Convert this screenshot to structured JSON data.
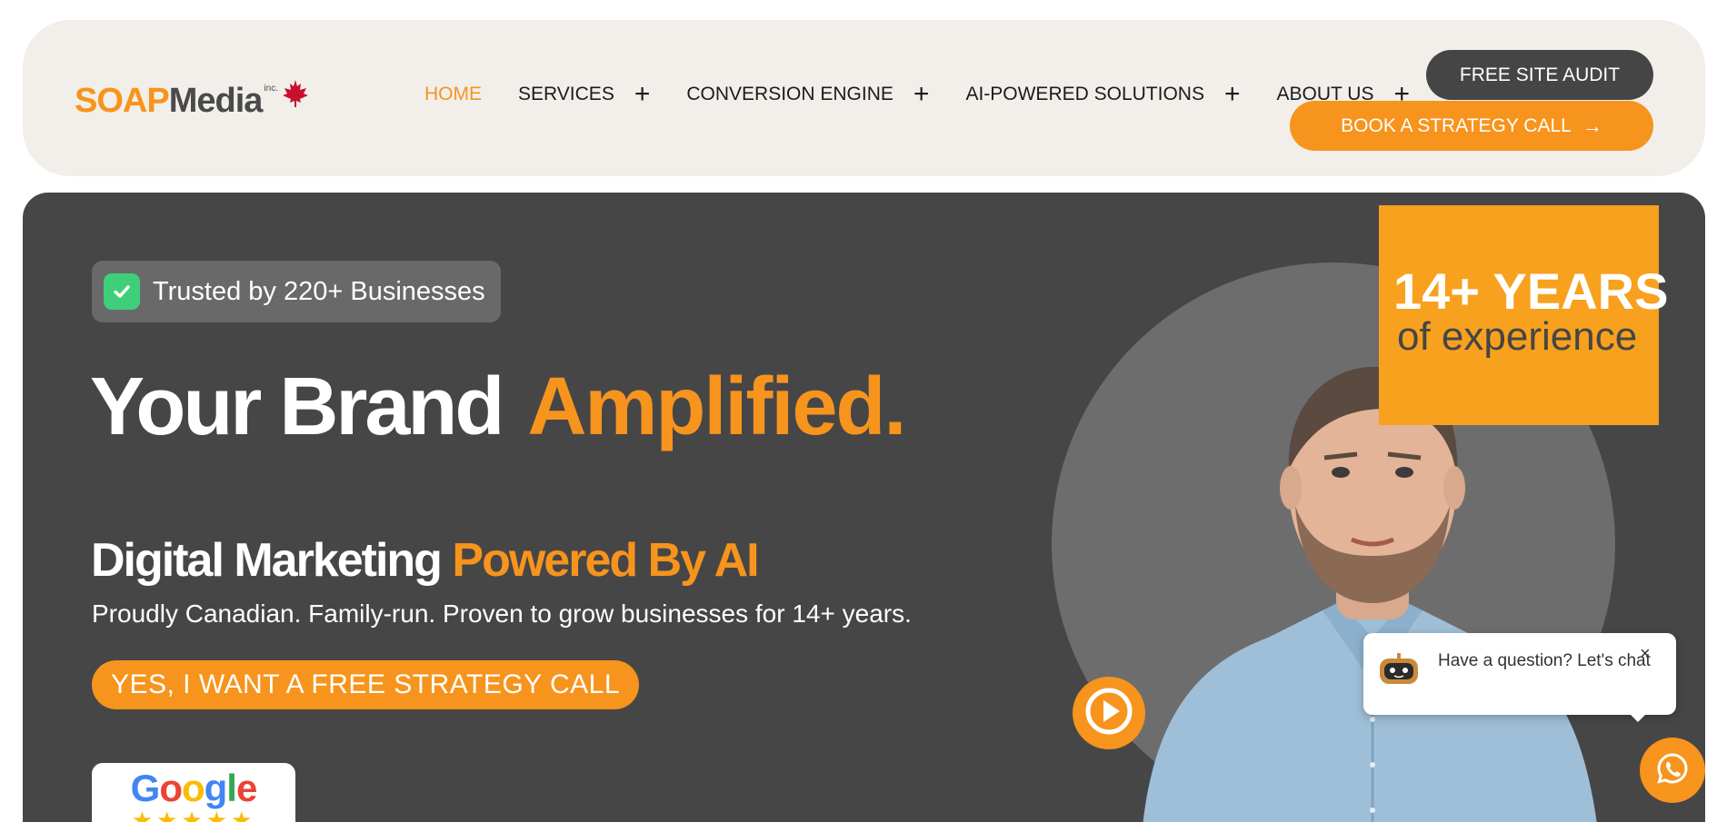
{
  "header": {
    "logo": {
      "part1": "SOAP",
      "part2": "Media",
      "inc": "inc."
    },
    "nav": [
      {
        "label": "HOME",
        "active": true,
        "has_submenu": false
      },
      {
        "label": "SERVICES",
        "active": false,
        "has_submenu": true
      },
      {
        "label": "CONVERSION ENGINE",
        "active": false,
        "has_submenu": true
      },
      {
        "label": "AI-POWERED SOLUTIONS",
        "active": false,
        "has_submenu": true
      },
      {
        "label": "ABOUT US",
        "active": false,
        "has_submenu": true
      }
    ],
    "submenu_glyph": "+",
    "audit_button": "FREE SITE AUDIT",
    "call_button": "BOOK A STRATEGY CALL",
    "call_arrow": "→"
  },
  "hero": {
    "badge_text": "Trusted by 220+ Businesses",
    "headline_white": "Your Brand",
    "headline_accent": "Amplified.",
    "subhead_white": "Digital Marketing",
    "subhead_accent": "Powered By AI",
    "tagline": "Proudly Canadian. Family-run. Proven to grow businesses for 14+ years.",
    "cta_button": "YES, I WANT A FREE STRATEGY CALL",
    "google": {
      "letters": [
        "G",
        "o",
        "o",
        "g",
        "l",
        "e"
      ],
      "stars": "★★★★★"
    },
    "years_big": "14+ YEARS",
    "years_small": "of experience"
  },
  "chat": {
    "message": "Have a question? Let's chat",
    "close": "×"
  },
  "colors": {
    "accent": "#f7941d",
    "dark": "#474647",
    "header_bg": "#f2efea",
    "check_green": "#3fcf7a"
  },
  "icons": [
    "maple-leaf-icon",
    "plus-icon",
    "arrow-right-icon",
    "check-icon",
    "play-icon",
    "chat-bot-avatar-icon",
    "close-icon",
    "whatsapp-icon"
  ]
}
